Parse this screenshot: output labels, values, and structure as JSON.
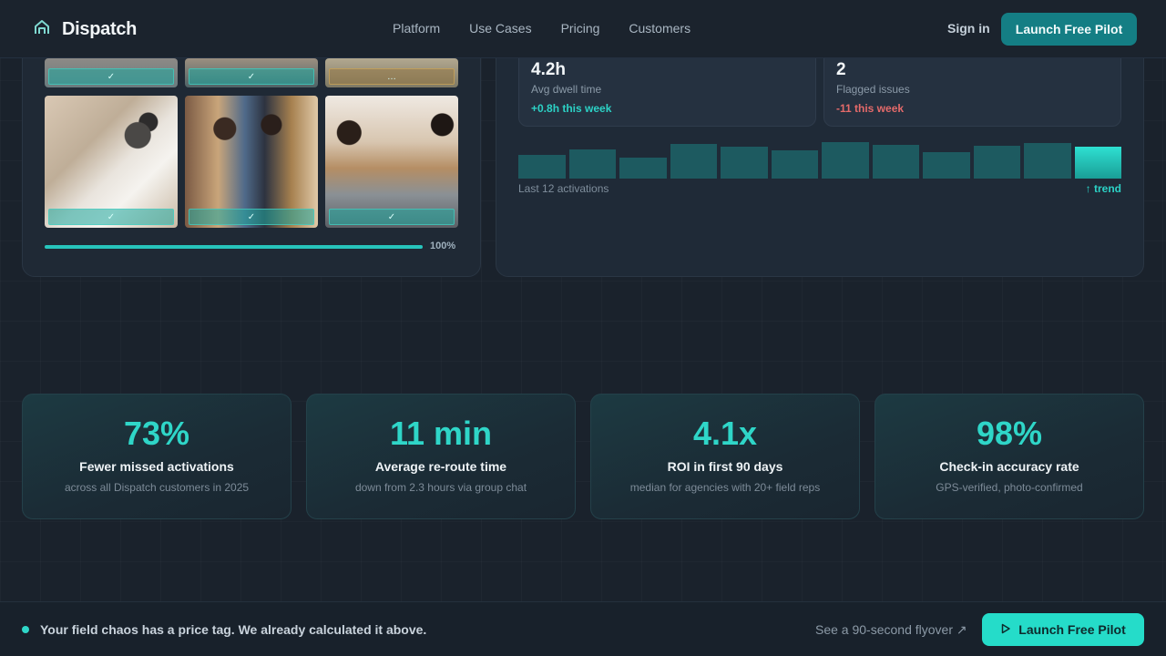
{
  "nav": {
    "brand": "Dispatch",
    "links": [
      "Platform",
      "Use Cases",
      "Pricing",
      "Customers"
    ],
    "sign_in": "Sign in",
    "cta": "Launch Free Pilot"
  },
  "gallery": {
    "badges": [
      "✓",
      "✓",
      "…",
      "✓",
      "✓",
      "✓"
    ],
    "progress_label": "100%",
    "progress_value": 1.0
  },
  "metrics": [
    {
      "value": "4.2h",
      "label": "Avg dwell time",
      "delta": "+0.8h this week",
      "delta_color": "#2cd2c6"
    },
    {
      "value": "2",
      "label": "Flagged issues",
      "delta": "-11 this week",
      "delta_color": "#e46a6a"
    }
  ],
  "activations": {
    "label": "Last 12 activations",
    "trend": "↑ trend",
    "values": [
      24,
      30,
      21,
      35,
      32,
      29,
      37,
      34,
      27,
      33,
      36,
      32
    ]
  },
  "stats": [
    {
      "value": "73%",
      "title": "Fewer missed activations",
      "sub": "across all Dispatch customers in 2025"
    },
    {
      "value": "11 min",
      "title": "Average re-route time",
      "sub": "down from 2.3 hours via group chat"
    },
    {
      "value": "4.1x",
      "title": "ROI in first 90 days",
      "sub": "median for agencies with 20+ field reps"
    },
    {
      "value": "98%",
      "title": "Check-in accuracy rate",
      "sub": "GPS-verified, photo-confirmed"
    }
  ],
  "bottom": {
    "message": "Your field chaos has a price tag. We already calculated it above.",
    "flyover": "See a 90-second flyover ↗",
    "cta": "Launch Free Pilot"
  },
  "colors": {
    "accent": "#2fd6c8",
    "negative": "#e46a6a"
  }
}
